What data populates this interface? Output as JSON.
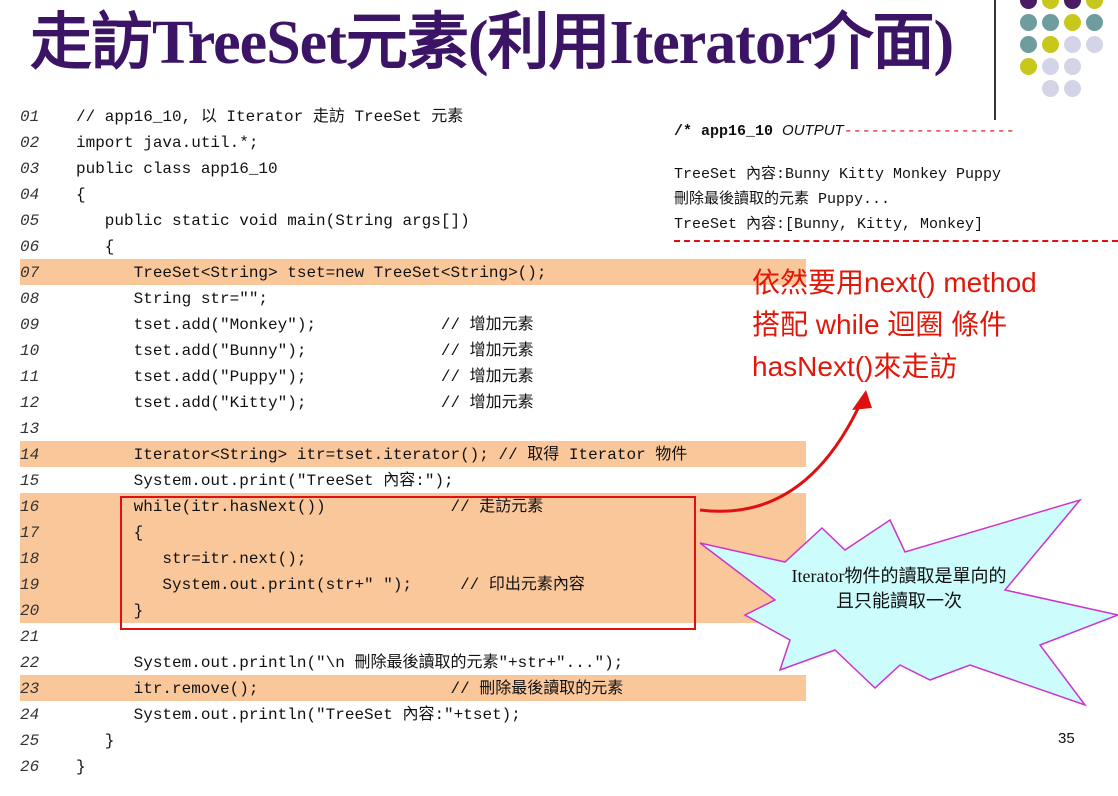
{
  "title": "走訪TreeSet元素(利用Iterator介面)",
  "code": [
    {
      "n": "01",
      "t": "// app16_10, 以 Iterator 走訪 TreeSet 元素",
      "hl": false
    },
    {
      "n": "02",
      "t": "import java.util.*;",
      "hl": false
    },
    {
      "n": "03",
      "t": "public class app16_10",
      "hl": false
    },
    {
      "n": "04",
      "t": "{",
      "hl": false
    },
    {
      "n": "05",
      "t": "   public static void main(String args[])",
      "hl": false
    },
    {
      "n": "06",
      "t": "   {",
      "hl": false
    },
    {
      "n": "07",
      "t": "      TreeSet<String> tset=new TreeSet<String>();",
      "hl": true
    },
    {
      "n": "08",
      "t": "      String str=\"\";",
      "hl": false
    },
    {
      "n": "09",
      "t": "      tset.add(\"Monkey\");             // 增加元素",
      "hl": false
    },
    {
      "n": "10",
      "t": "      tset.add(\"Bunny\");              // 增加元素",
      "hl": false
    },
    {
      "n": "11",
      "t": "      tset.add(\"Puppy\");              // 增加元素",
      "hl": false
    },
    {
      "n": "12",
      "t": "      tset.add(\"Kitty\");              // 增加元素",
      "hl": false
    },
    {
      "n": "13",
      "t": "",
      "hl": false
    },
    {
      "n": "14",
      "t": "      Iterator<String> itr=tset.iterator(); // 取得 Iterator 物件",
      "hl": true
    },
    {
      "n": "15",
      "t": "      System.out.print(\"TreeSet 內容:\");",
      "hl": false
    },
    {
      "n": "16",
      "t": "      while(itr.hasNext())             // 走訪元素",
      "hl": true
    },
    {
      "n": "17",
      "t": "      {",
      "hl": true
    },
    {
      "n": "18",
      "t": "         str=itr.next();",
      "hl": true
    },
    {
      "n": "19",
      "t": "         System.out.print(str+\" \");     // 印出元素內容",
      "hl": true
    },
    {
      "n": "20",
      "t": "      }",
      "hl": true
    },
    {
      "n": "21",
      "t": "",
      "hl": false
    },
    {
      "n": "22",
      "t": "      System.out.println(\"\\n 刪除最後讀取的元素\"+str+\"...\");",
      "hl": false
    },
    {
      "n": "23",
      "t": "      itr.remove();                    // 刪除最後讀取的元素",
      "hl": true
    },
    {
      "n": "24",
      "t": "      System.out.println(\"TreeSet 內容:\"+tset);",
      "hl": false
    },
    {
      "n": "25",
      "t": "   }",
      "hl": false
    },
    {
      "n": "26",
      "t": "}",
      "hl": false
    }
  ],
  "output": {
    "head_comment": "/* app16_10 ",
    "head_label": "OUTPUT",
    "head_dashes": "-------------------",
    "lines": [
      "TreeSet 內容:Bunny Kitty Monkey Puppy",
      "刪除最後讀取的元素 Puppy...",
      "TreeSet 內容:[Bunny, Kitty, Monkey]"
    ]
  },
  "note_red": "依然要用next() method\n搭配 while 迴圈 條件\nhasNext()來走訪",
  "note_star": "Iterator物件的讀取是單向的且只能讀取一次",
  "page_number": "35",
  "colors": {
    "title": "#3b1466",
    "highlight": "#fac79a",
    "red": "#e01010",
    "star_fill": "#ccfcfc",
    "dot_purple": "#4b1b63",
    "dot_teal": "#6f9c9c",
    "dot_olive": "#c8c81a",
    "dot_lavender": "#d4d4e8"
  }
}
